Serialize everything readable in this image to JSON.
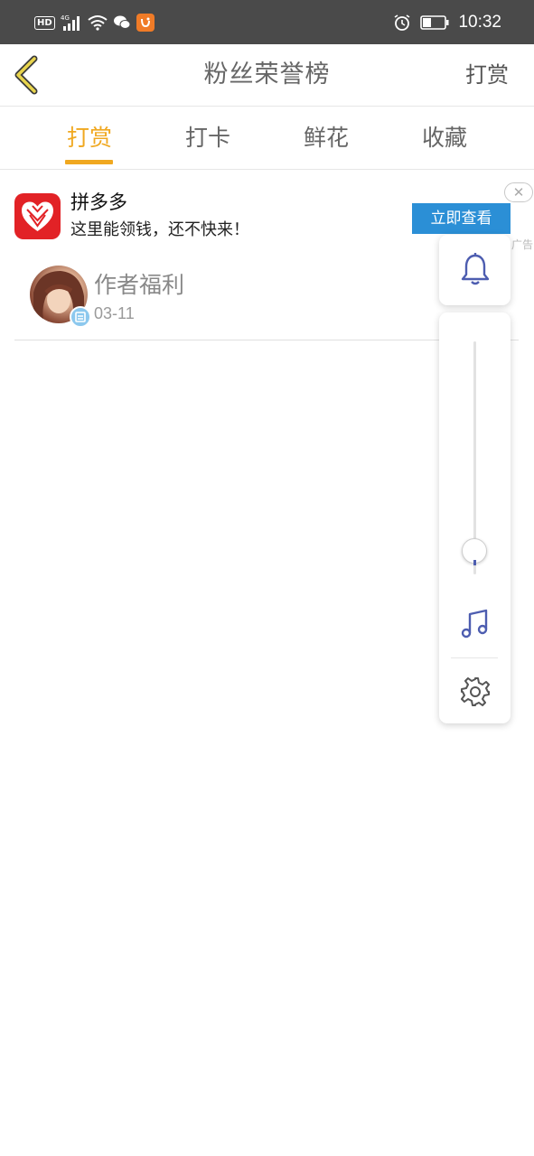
{
  "status_bar": {
    "left_icons": [
      "hd-badge",
      "signal-4g-icon",
      "wifi-icon",
      "wechat-icon",
      "uc-browser-icon"
    ],
    "hd_label": "HD",
    "right_icons": [
      "alarm-icon",
      "battery-icon"
    ],
    "time": "10:32"
  },
  "header": {
    "back_icon": "chevron-left-icon",
    "title": "粉丝荣誉榜",
    "action_label": "打赏"
  },
  "tabs": {
    "items": [
      {
        "label": "打赏",
        "active": true
      },
      {
        "label": "打卡",
        "active": false
      },
      {
        "label": "鲜花",
        "active": false
      },
      {
        "label": "收藏",
        "active": false
      }
    ],
    "active_color": "#f0a820",
    "inactive_color": "#666666"
  },
  "ad": {
    "app_name": "拼多多",
    "description": "这里能领钱，还不快来！",
    "cta_label": "立即查看",
    "close_glyph": "✕",
    "ad_label": "广告",
    "logo_color": "#e22226",
    "cta_color": "#2b8fd6"
  },
  "list": {
    "items": [
      {
        "name": "作者福利",
        "date": "03-11",
        "avatar_icon": "user-avatar",
        "badge_icon": "author-badge-icon"
      }
    ]
  },
  "floating_controls": {
    "bell_icon": "bell-icon",
    "slider_level": 0.1,
    "music_icon": "music-note-icon",
    "settings_icon": "gear-icon",
    "icon_color": "#4d5db0"
  }
}
